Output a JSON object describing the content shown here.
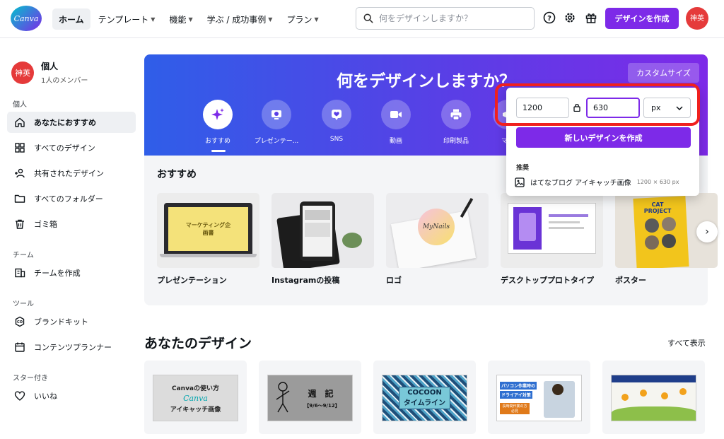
{
  "app": {
    "logo_text": "Canva",
    "accent_color": "#7d2ae8",
    "brand_color": "#00c4cc"
  },
  "nav": {
    "items": [
      {
        "label": "ホーム",
        "active": true,
        "caret": false
      },
      {
        "label": "テンプレート",
        "active": false,
        "caret": true
      },
      {
        "label": "機能",
        "active": false,
        "caret": true
      },
      {
        "label": "学ぶ / 成功事例",
        "active": false,
        "caret": true
      },
      {
        "label": "プラン",
        "active": false,
        "caret": true
      }
    ],
    "search_placeholder": "何をデザインしますか？",
    "create_button": "デザインを作成",
    "avatar_text": "神英"
  },
  "sidebar": {
    "team_name": "個人",
    "team_members": "1人のメンバー",
    "team_avatar": "神英",
    "section_personal": "個人",
    "items_personal": [
      {
        "label": "あなたにおすすめ",
        "icon": "home-icon",
        "active": true
      },
      {
        "label": "すべてのデザイン",
        "icon": "grid-icon",
        "active": false
      },
      {
        "label": "共有されたデザイン",
        "icon": "share-users-icon",
        "active": false
      },
      {
        "label": "すべてのフォルダー",
        "icon": "folder-icon",
        "active": false
      },
      {
        "label": "ゴミ箱",
        "icon": "trash-icon",
        "active": false
      }
    ],
    "section_team": "チーム",
    "items_team": [
      {
        "label": "チームを作成",
        "icon": "team-building-icon",
        "active": false
      }
    ],
    "section_tools": "ツール",
    "items_tools": [
      {
        "label": "ブランドキット",
        "icon": "brand-kit-icon",
        "active": false
      },
      {
        "label": "コンテンツプランナー",
        "icon": "calendar-icon",
        "active": false
      }
    ],
    "section_starred": "スター付き",
    "items_starred": [
      {
        "label": "いいね",
        "icon": "heart-icon",
        "active": false
      }
    ]
  },
  "hero": {
    "title": "何をデザインしますか？",
    "custom_size_button": "カスタムサイズ",
    "categories": [
      {
        "label": "おすすめ",
        "icon": "sparkle-icon",
        "selected": true
      },
      {
        "label": "プレゼンテー...",
        "icon": "presentation-icon",
        "selected": false
      },
      {
        "label": "SNS",
        "icon": "heart-bubble-icon",
        "selected": false
      },
      {
        "label": "動画",
        "icon": "video-icon",
        "selected": false
      },
      {
        "label": "印刷製品",
        "icon": "printer-icon",
        "selected": false
      },
      {
        "label": "マー",
        "icon": "marketing-icon",
        "selected": false
      }
    ]
  },
  "popover": {
    "width_value": "1200",
    "height_value": "630",
    "unit": "px",
    "create_button": "新しいデザインを作成",
    "recommended_label": "推奨",
    "recommended_item": "はてなブログ アイキャッチ画像",
    "recommended_size": "1200 × 630 px"
  },
  "recommended": {
    "title": "おすすめ",
    "cards": [
      {
        "label": "プレゼンテーション",
        "thumb_text": "マーケティング企画書"
      },
      {
        "label": "Instagramの投稿",
        "thumb_text": ""
      },
      {
        "label": "ロゴ",
        "thumb_text": "MyNails"
      },
      {
        "label": "デスクトッププロトタイプ",
        "thumb_text": ""
      },
      {
        "label": "ポスター",
        "thumb_text": "CAT PROJECT"
      }
    ]
  },
  "your_designs": {
    "title": "あなたのデザイン",
    "see_all": "すべて表示",
    "designs": [
      {
        "line1": "Canvaの使い方",
        "line2": "Canva",
        "line3": "アイキャッチ画像"
      },
      {
        "line1": "週　記",
        "line2": "【9/6〜9/12】",
        "line3": ""
      },
      {
        "line1": "COCOON",
        "line2": "タイムライン",
        "line3": ""
      },
      {
        "line1": "パソコン作業時の",
        "line2": "ドライアイ対策",
        "line3": "長時間作業の方必見"
      },
      {
        "line1": "",
        "line2": "",
        "line3": ""
      }
    ]
  }
}
